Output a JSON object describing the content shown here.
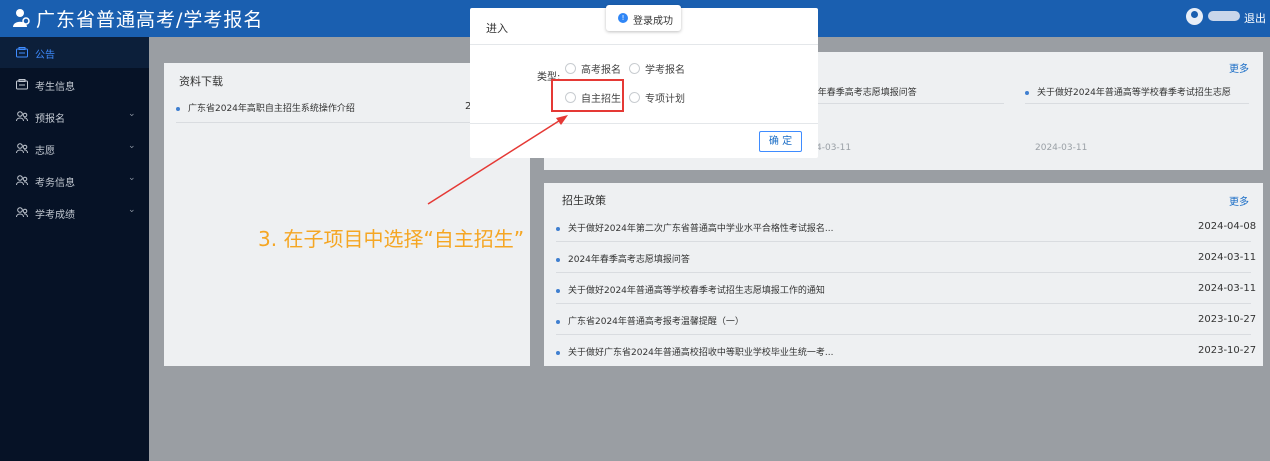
{
  "header": {
    "app_title": "广东省普通高考/学考报名",
    "username": "",
    "logout_label": "退出"
  },
  "sidebar": {
    "items": [
      {
        "label": "公告",
        "icon": "announcement-icon",
        "active": true
      },
      {
        "label": "考生信息",
        "icon": "id-card-icon"
      },
      {
        "label": "预报名",
        "icon": "users-icon"
      },
      {
        "label": "志愿",
        "icon": "users-icon"
      },
      {
        "label": "考务信息",
        "icon": "users-icon"
      },
      {
        "label": "学考成绩",
        "icon": "users-icon"
      }
    ]
  },
  "downloads": {
    "title": "资料下载",
    "items": [
      {
        "text": "广东省2024年高职自主招生系统操作介绍",
        "date": "2"
      }
    ]
  },
  "notices": {
    "more_label": "更多",
    "items": [
      {
        "text": "4年春季高考志愿填报问答",
        "date": "4-03-11"
      },
      {
        "text": "关于做好2024年普通高等学校春季考试招生志愿",
        "date": "2024-03-11"
      }
    ]
  },
  "policy": {
    "title": "招生政策",
    "more_label": "更多",
    "items": [
      {
        "text": "关于做好2024年第二次广东省普通高中学业水平合格性考试报名...",
        "date": "2024-04-08"
      },
      {
        "text": "2024年春季高考志愿填报问答",
        "date": "2024-03-11"
      },
      {
        "text": "关于做好2024年普通高等学校春季考试招生志愿填报工作的通知",
        "date": "2024-03-11"
      },
      {
        "text": "广东省2024年普通高考报考温馨提醒（一）",
        "date": "2023-10-27"
      },
      {
        "text": "关于做好广东省2024年普通高校招收中等职业学校毕业生统一考...",
        "date": "2023-10-27"
      }
    ]
  },
  "dialog": {
    "title": "进入",
    "type_label": "类型:",
    "options": [
      "高考报名",
      "学考报名",
      "自主招生",
      "专项计划"
    ],
    "confirm_label": "确 定"
  },
  "toast": {
    "text": "登录成功"
  },
  "annotation": {
    "instruction": "3. 在子项目中选择“自主招生”",
    "color": "#f5a623",
    "box_color": "#e53935"
  }
}
